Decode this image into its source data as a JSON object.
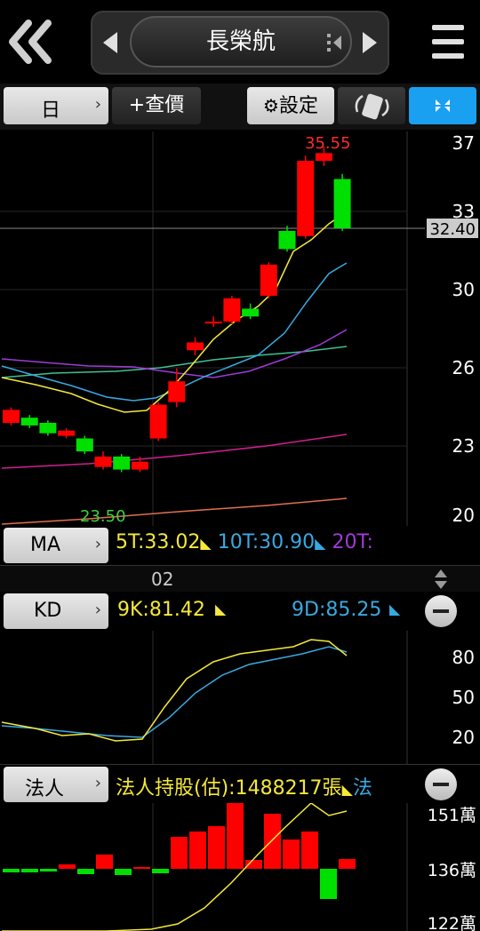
{
  "header": {
    "title": "長榮航",
    "back_icon": "double-chevron-left-icon",
    "prev_icon": "triangle-left-icon",
    "next_icon": "triangle-right-icon",
    "menu_icon": "hamburger-menu-icon"
  },
  "toolbar": {
    "period_label": "日",
    "add_query_label": "+查價",
    "settings_label": "設定",
    "rotate_icon": "rotate-phone-icon",
    "collapse_icon": "collapse-icon"
  },
  "price_chart": {
    "high_label": "35.55",
    "low_label": "23.50",
    "current_price": "32.40",
    "y_ticks": [
      "37",
      "33",
      "30",
      "26",
      "23",
      "20"
    ]
  },
  "ma_panel": {
    "label": "MA",
    "ma5": "5T:33.02",
    "ma10": "10T:30.90",
    "ma20": "20T:"
  },
  "date_axis": {
    "month_label": "02"
  },
  "kd_panel": {
    "label": "KD",
    "k_value": "9K:81.42",
    "d_value": "9D:85.25",
    "y_ticks": [
      "80",
      "50",
      "20"
    ]
  },
  "inst_panel": {
    "label": "法人",
    "holding": "法人持股(估):1488217張",
    "more": "法",
    "y_ticks": [
      "151萬",
      "136萬",
      "122萬"
    ]
  },
  "colors": {
    "up": "#ff0000",
    "down": "#00e000",
    "ma5": "#f5e83a",
    "ma10": "#3aa8e0",
    "ma20": "#a03ad8",
    "accent_blue": "#1aa0f0"
  },
  "chart_data": {
    "type": "candlestick",
    "candles": [
      {
        "o": 24.9,
        "c": 25.4,
        "h": 25.5,
        "l": 24.8
      },
      {
        "o": 25.1,
        "c": 24.8,
        "h": 25.2,
        "l": 24.7
      },
      {
        "o": 24.9,
        "c": 24.5,
        "h": 25.0,
        "l": 24.4
      },
      {
        "o": 24.4,
        "c": 24.6,
        "h": 24.7,
        "l": 24.3
      },
      {
        "o": 24.3,
        "c": 23.8,
        "h": 24.4,
        "l": 23.7
      },
      {
        "o": 23.2,
        "c": 23.6,
        "h": 23.8,
        "l": 23.1
      },
      {
        "o": 23.6,
        "c": 23.1,
        "h": 23.7,
        "l": 23.0
      },
      {
        "o": 23.1,
        "c": 23.4,
        "h": 23.6,
        "l": 23.0
      },
      {
        "o": 24.3,
        "c": 25.6,
        "h": 25.7,
        "l": 24.2
      },
      {
        "o": 25.7,
        "c": 26.5,
        "h": 27.0,
        "l": 25.5
      },
      {
        "o": 27.7,
        "c": 28.0,
        "h": 28.2,
        "l": 27.5
      },
      {
        "o": 28.8,
        "c": 28.8,
        "h": 29.0,
        "l": 28.6
      },
      {
        "o": 28.8,
        "c": 29.7,
        "h": 29.8,
        "l": 28.7
      },
      {
        "o": 29.3,
        "c": 29.0,
        "h": 29.5,
        "l": 28.9
      },
      {
        "o": 29.8,
        "c": 31.0,
        "h": 31.1,
        "l": 29.7
      },
      {
        "o": 32.3,
        "c": 31.6,
        "h": 32.5,
        "l": 31.5
      },
      {
        "o": 32.1,
        "c": 35.0,
        "h": 35.2,
        "l": 32.0
      },
      {
        "o": 35.0,
        "c": 35.3,
        "h": 35.55,
        "l": 34.8
      },
      {
        "o": 34.3,
        "c": 32.4,
        "h": 34.5,
        "l": 32.3
      }
    ]
  }
}
